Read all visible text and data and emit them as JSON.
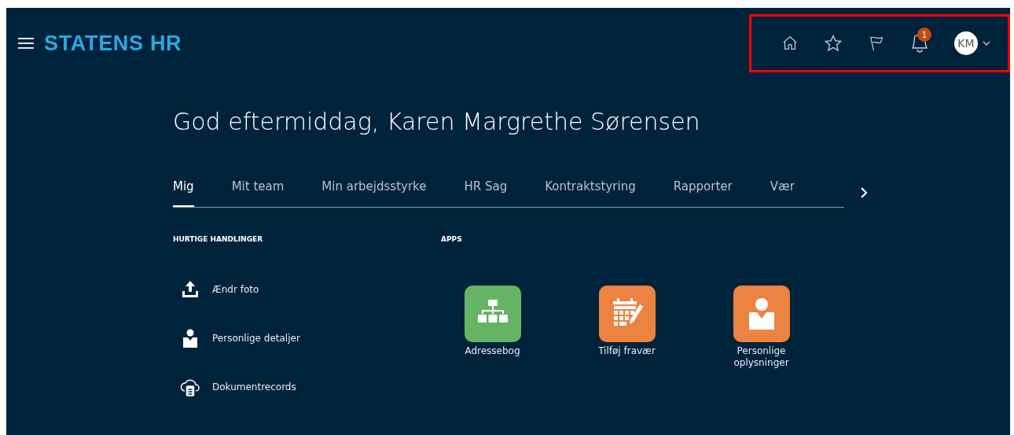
{
  "header": {
    "brand": "STATENS HR",
    "notifications": {
      "badge": "1"
    },
    "avatar": {
      "initials": "KM"
    }
  },
  "greeting": "God eftermiddag, Karen Margrethe Sørensen",
  "tabs": [
    {
      "label": "Mig",
      "selected": true
    },
    {
      "label": "Mit team",
      "selected": false
    },
    {
      "label": "Min arbejdsstyrke",
      "selected": false
    },
    {
      "label": "HR Sag",
      "selected": false
    },
    {
      "label": "Kontraktstyring",
      "selected": false
    },
    {
      "label": "Rapporter",
      "selected": false
    },
    {
      "label": "Vær",
      "selected": false
    }
  ],
  "quick_actions": {
    "heading": "HURTIGE HANDLINGER",
    "items": [
      {
        "label": "Ændr foto",
        "kind": "upload"
      },
      {
        "label": "Personlige detaljer",
        "kind": "person"
      },
      {
        "label": "Dokumentrecords",
        "kind": "cloud"
      }
    ]
  },
  "apps": {
    "heading": "APPS",
    "items": [
      {
        "label": "Adressebog",
        "kind": "org",
        "color": "#67b364"
      },
      {
        "label": "Tilføj fravær",
        "kind": "calendar",
        "color": "#ec8340"
      },
      {
        "label": "Personlige oplysninger",
        "kind": "person",
        "color": "#ec8340"
      }
    ]
  }
}
